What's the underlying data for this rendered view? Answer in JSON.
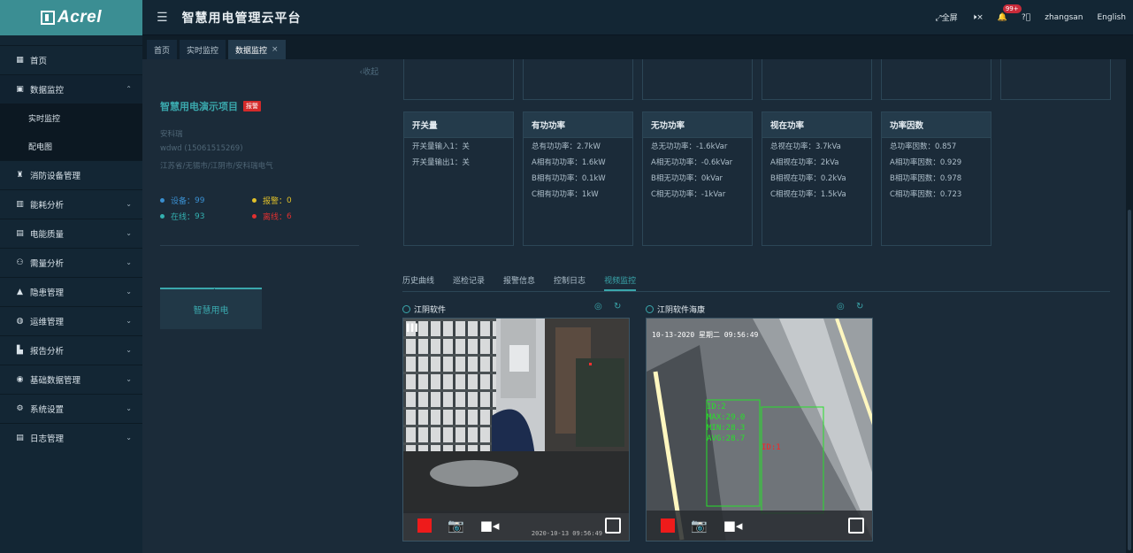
{
  "brand": {
    "logo_text": "Acrel",
    "title": "智慧用电管理云平台"
  },
  "topbar": {
    "fullscreen": "全屏",
    "badge": "99+",
    "user": "zhangsan",
    "lang": "English"
  },
  "menu": [
    {
      "label": "首页",
      "icon": "grid-icon"
    },
    {
      "label": "数据监控",
      "icon": "monitor-icon",
      "expanded": true,
      "sub": [
        "实时监控",
        "配电图"
      ]
    },
    {
      "label": "消防设备管理",
      "icon": "extinguisher-icon"
    },
    {
      "label": "能耗分析",
      "icon": "bar-chart-icon"
    },
    {
      "label": "电能质量",
      "icon": "calendar-icon"
    },
    {
      "label": "需量分析",
      "icon": "hierarchy-icon"
    },
    {
      "label": "隐患管理",
      "icon": "warning-icon"
    },
    {
      "label": "运维管理",
      "icon": "globe-icon"
    },
    {
      "label": "报告分析",
      "icon": "report-icon"
    },
    {
      "label": "基础数据管理",
      "icon": "database-icon"
    },
    {
      "label": "系统设置",
      "icon": "settings-icon"
    },
    {
      "label": "日志管理",
      "icon": "log-icon"
    }
  ],
  "tabs": [
    "首页",
    "实时监控",
    "数据监控"
  ],
  "left": {
    "collapse": "收起",
    "project": "智慧用电演示项目",
    "alarm_tag": "报警",
    "company": "安科瑞",
    "contact": "wdwd (15061515269)",
    "address": "江苏省/无锡市/江阴市/安科瑞电气",
    "stats": [
      {
        "label": "设备",
        "value": "99",
        "color": "#3a8fd0"
      },
      {
        "label": "报警",
        "value": "0",
        "color": "#e0c02a"
      },
      {
        "label": "在线",
        "value": "93",
        "color": "#33b0b0"
      },
      {
        "label": "离线",
        "value": "6",
        "color": "#e03030"
      }
    ],
    "smart_label": "智慧用电"
  },
  "cards": [
    {
      "title": "开关量",
      "rows": [
        "开关量输入1：关",
        "开关量输出1：关"
      ]
    },
    {
      "title": "有功功率",
      "rows": [
        "总有功功率：2.7kW",
        "A相有功功率：1.6kW",
        "B相有功功率：0.1kW",
        "C相有功功率：1kW"
      ]
    },
    {
      "title": "无功功率",
      "rows": [
        "总无功功率：-1.6kVar",
        "A相无功功率：-0.6kVar",
        "B相无功功率：0kVar",
        "C相无功功率：-1kVar"
      ]
    },
    {
      "title": "视在功率",
      "rows": [
        "总视在功率：3.7kVa",
        "A相视在功率：2kVa",
        "B相视在功率：0.2kVa",
        "C相视在功率：1.5kVa"
      ]
    },
    {
      "title": "功率因数",
      "rows": [
        "总功率因数：0.857",
        "A相功率因数：0.929",
        "B相功率因数：0.978",
        "C相功率因数：0.723"
      ]
    }
  ],
  "history_tabs": [
    "历史曲线",
    "巡检记录",
    "报警信息",
    "控制日志",
    "视频监控"
  ],
  "cameras": [
    {
      "name": "江阴软件",
      "osd_bottom": "2020-10-13 09:56:49"
    },
    {
      "name": "江阴软件海康",
      "osd_top": "10-13-2020 星期二 09:56:49",
      "thermal": [
        "ID:2",
        "MAX:29.0",
        "MIN:28.3",
        "AVG:28.7"
      ],
      "alarm": "ID:1"
    }
  ]
}
